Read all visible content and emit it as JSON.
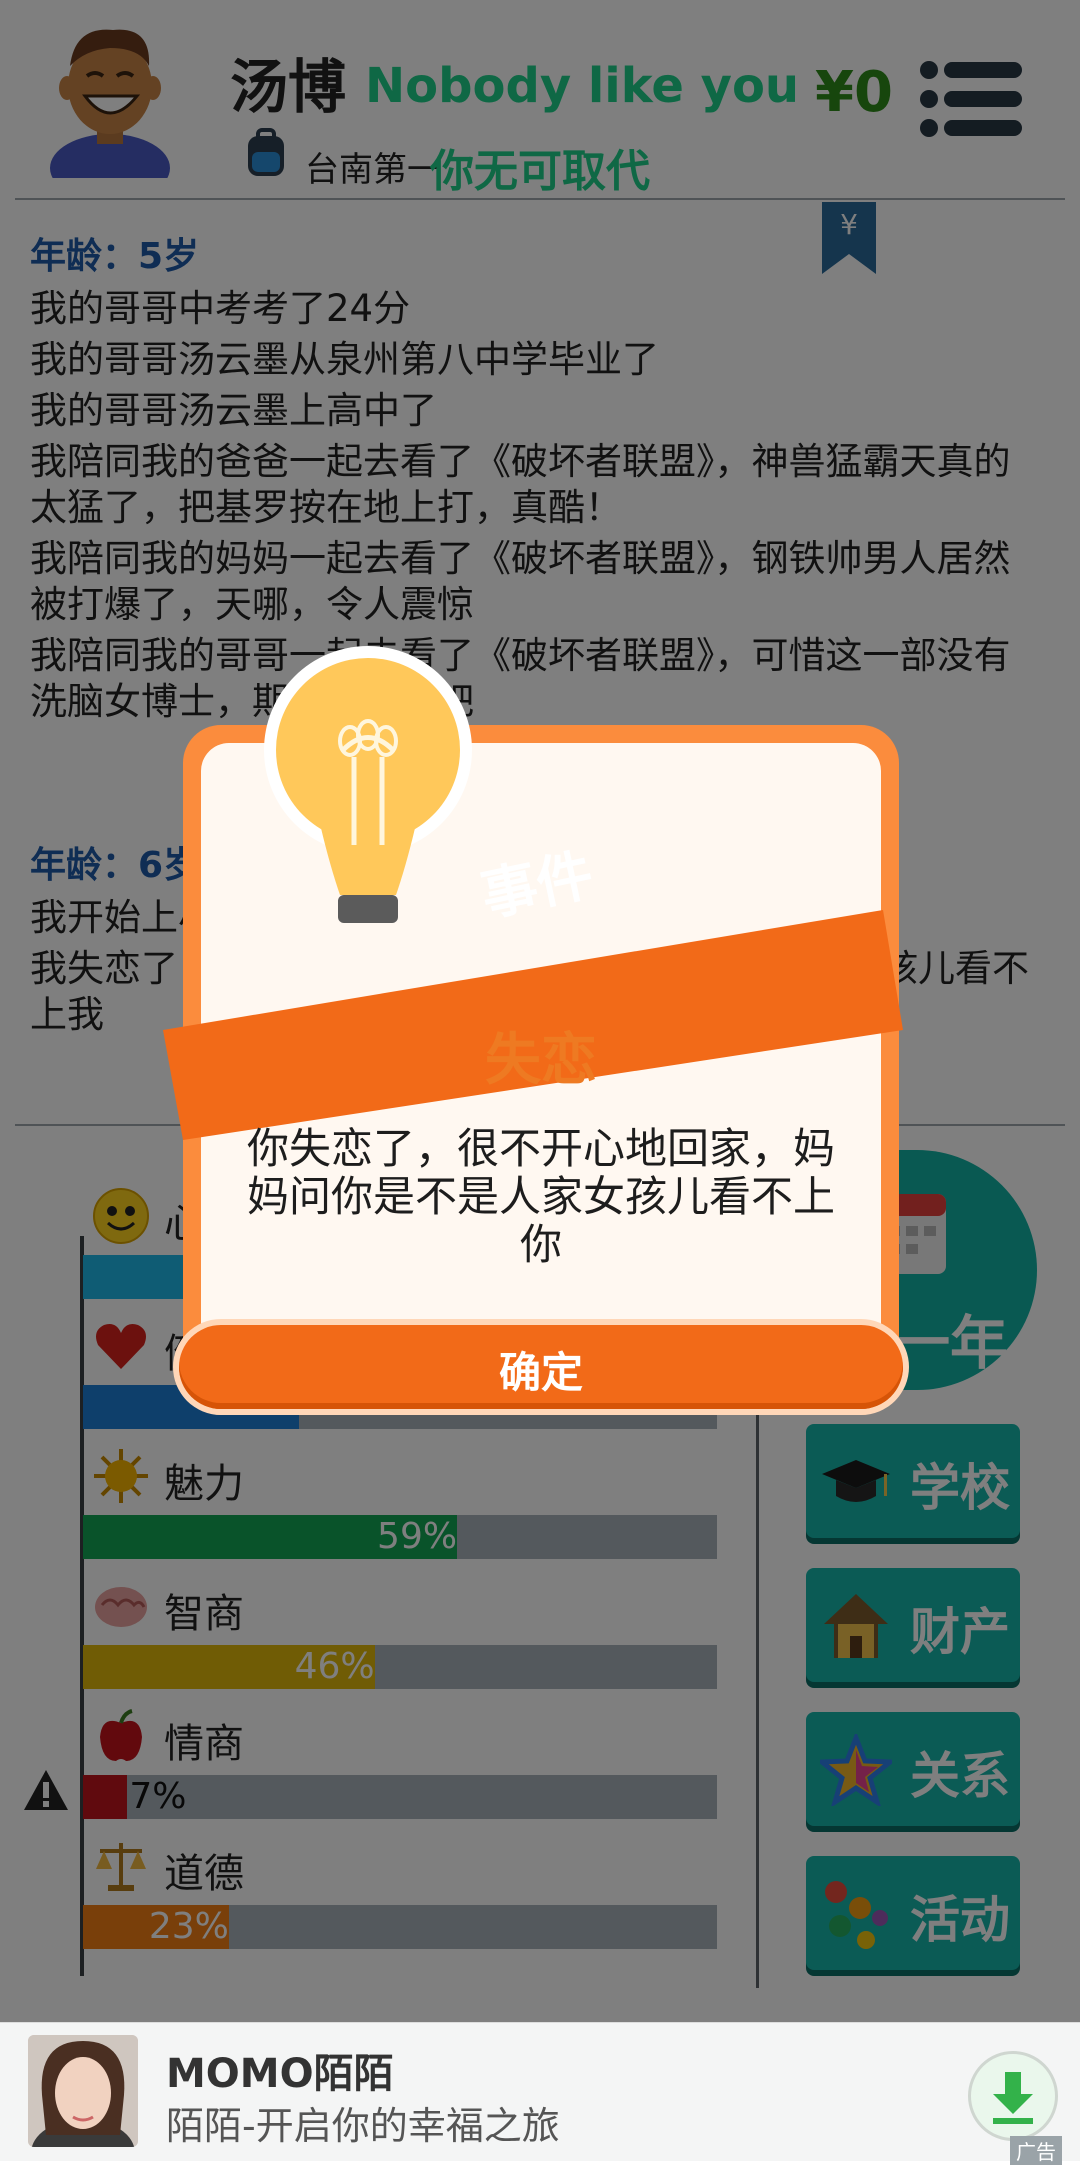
{
  "header": {
    "name": "汤博",
    "tagline_en": "Nobody like you",
    "subtitle": "台南第一",
    "tagline_cn": "你无可取代",
    "money": "¥0"
  },
  "log": {
    "section1": {
      "age": "年龄：5岁",
      "entries": [
        "我的哥哥中考考了24分",
        "我的哥哥汤云墨从泉州第八中学毕业了",
        "我的哥哥汤云墨上高中了",
        "我陪同我的爸爸一起去看了《破坏者联盟》，神兽猛霸天真的太猛了，把基罗按在地上打，真酷！",
        "我陪同我的妈妈一起去看了《破坏者联盟》，钢铁帅男人居然被打爆了，天哪，令人震惊",
        "我陪同我的哥哥一起去看了《破坏者联盟》，可惜这一部没有洗脑女博士，期待下一部吧"
      ]
    },
    "section2": {
      "age": "年龄：6岁",
      "entries": [
        "我开始上小学了",
        "我失恋了，很不开心地回家，妈妈问我是不是人家女孩儿看不上我"
      ]
    }
  },
  "stats": [
    {
      "label": "心情",
      "value": 100,
      "color": "#1fb8e8",
      "icon": "smiley-icon"
    },
    {
      "label": "健康",
      "value": 34,
      "color": "#1d7fd6",
      "icon": "heart-icon"
    },
    {
      "label": "魅力",
      "value": 59,
      "value_text": "59%",
      "color": "#12a655",
      "icon": "sun-icon"
    },
    {
      "label": "智商",
      "value": 46,
      "value_text": "46%",
      "color": "#e1b90b",
      "icon": "brain-icon"
    },
    {
      "label": "情商",
      "value": 7,
      "value_text": "7%",
      "color": "#c0141c",
      "icon": "apple-icon"
    },
    {
      "label": "道德",
      "value": 23,
      "value_text": "23%",
      "color": "#f37e14",
      "icon": "scales-icon"
    }
  ],
  "side_buttons": [
    {
      "label": "学校",
      "icon": "graduation-cap-icon"
    },
    {
      "label": "财产",
      "icon": "house-icon"
    },
    {
      "label": "关系",
      "icon": "star-icon"
    },
    {
      "label": "活动",
      "icon": "molecule-icon"
    }
  ],
  "next_year": {
    "label": "一年",
    "icon": "calendar-icon"
  },
  "dialog": {
    "ribbon": "事件",
    "title": "失恋",
    "body": "你失恋了，很不开心地回家，妈妈问你是不是人家女孩儿看不上你",
    "confirm": "确定"
  },
  "ad": {
    "title": "MOMO陌陌",
    "subtitle": "陌陌-开启你的幸福之旅",
    "tag": "广告"
  }
}
